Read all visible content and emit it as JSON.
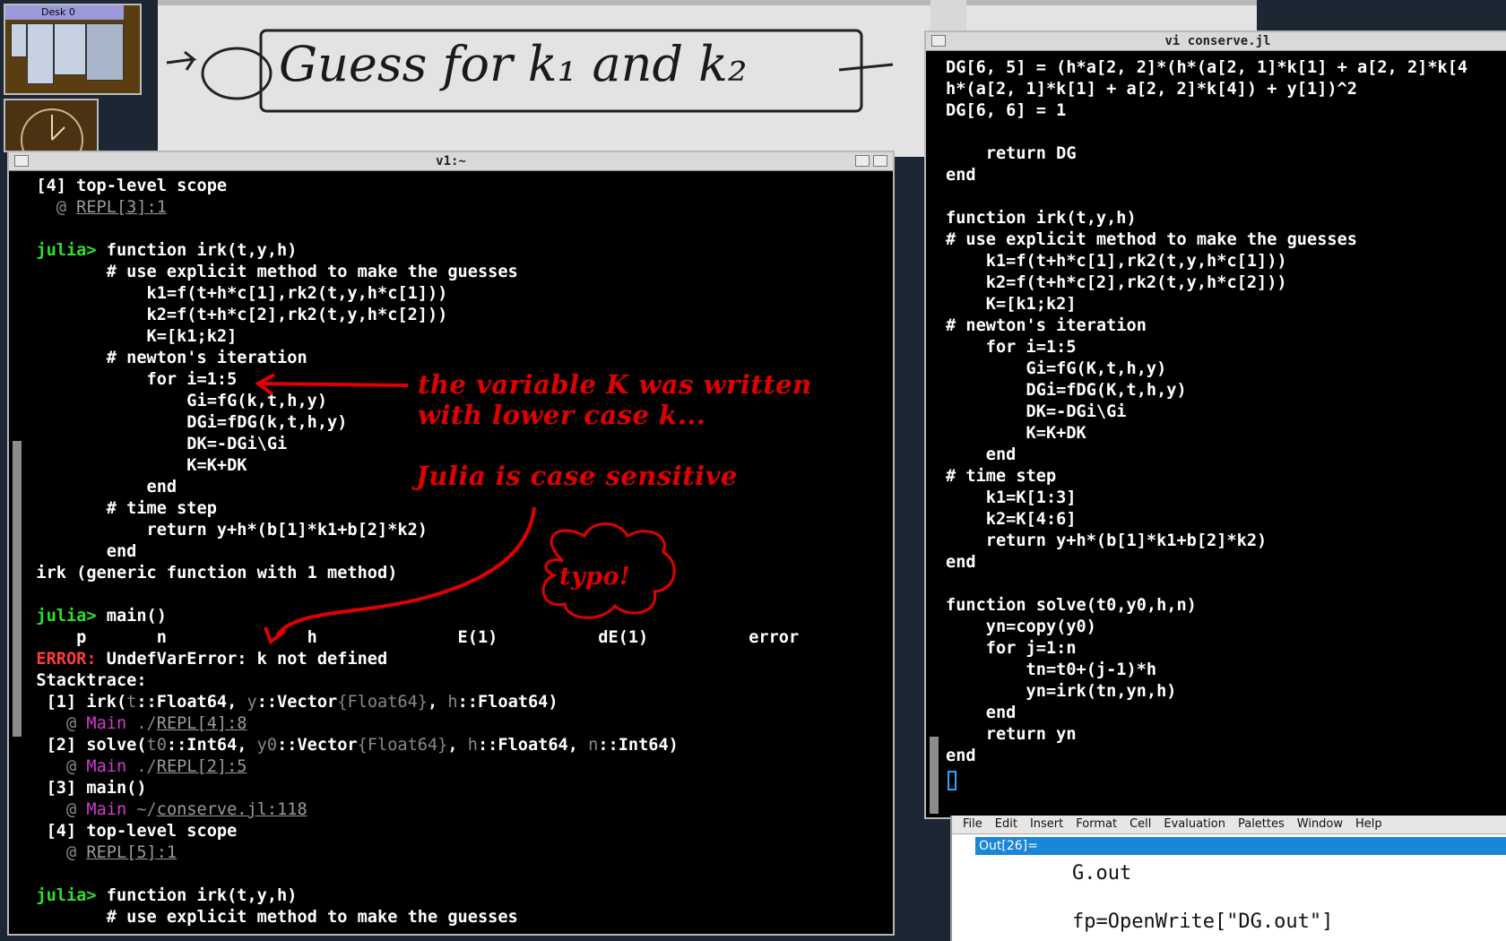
{
  "pager": {
    "title": "Desk 0"
  },
  "paper": {
    "handwriting": "Guess for k₁ and k₂"
  },
  "left_window": {
    "title": "v1:~",
    "lines": [
      [
        [
          "  [4] top-level scope",
          "b"
        ]
      ],
      [
        [
          "    @ ",
          "gr"
        ],
        [
          "REPL[3]:1",
          "u"
        ]
      ],
      [
        [
          "",
          ""
        ]
      ],
      [
        [
          "  julia> ",
          "g"
        ],
        [
          "function irk(t,y,h)",
          "b"
        ]
      ],
      [
        [
          "         # use explicit method to make the guesses",
          "b"
        ]
      ],
      [
        [
          "             k1=f(t+h*c[1],rk2(t,y,h*c[1]))",
          "b"
        ]
      ],
      [
        [
          "             k2=f(t+h*c[2],rk2(t,y,h*c[2]))",
          "b"
        ]
      ],
      [
        [
          "             K=[k1;k2]",
          "b"
        ]
      ],
      [
        [
          "         # newton's iteration",
          "b"
        ]
      ],
      [
        [
          "             for i=1:5",
          "b"
        ]
      ],
      [
        [
          "                 Gi=fG(k,t,h,y)",
          "b"
        ]
      ],
      [
        [
          "                 DGi=fDG(k,t,h,y)",
          "b"
        ]
      ],
      [
        [
          "                 DK=-DGi\\Gi",
          "b"
        ]
      ],
      [
        [
          "                 K=K+DK",
          "b"
        ]
      ],
      [
        [
          "             end",
          "b"
        ]
      ],
      [
        [
          "         # time step",
          "b"
        ]
      ],
      [
        [
          "             return y+h*(b[1]*k1+b[2]*k2)",
          "b"
        ]
      ],
      [
        [
          "         end",
          "b"
        ]
      ],
      [
        [
          "  irk (generic function with 1 method)",
          "b"
        ]
      ],
      [
        [
          "",
          ""
        ]
      ],
      [
        [
          "  julia> ",
          "g"
        ],
        [
          "main()",
          "b"
        ]
      ],
      [
        [
          "      p       n              h              E(1)          dE(1)          error",
          "b"
        ]
      ],
      [
        [
          "  ERROR: ",
          "r"
        ],
        [
          "UndefVarError: k not defined",
          "b"
        ]
      ],
      [
        [
          "  Stacktrace:",
          "b"
        ]
      ],
      [
        [
          "   [1] irk(",
          "b"
        ],
        [
          "t",
          "gr"
        ],
        [
          "::Float64, ",
          "b"
        ],
        [
          "y",
          "gr"
        ],
        [
          "::Vector",
          "b"
        ],
        [
          "{Float64}",
          "gr"
        ],
        [
          ", ",
          "b"
        ],
        [
          "h",
          "gr"
        ],
        [
          "::Float64)",
          "b"
        ]
      ],
      [
        [
          "     @ ",
          "gr"
        ],
        [
          "Main",
          "m"
        ],
        [
          " ./",
          "gr"
        ],
        [
          "REPL[4]:8",
          "u"
        ]
      ],
      [
        [
          "   [2] solve(",
          "b"
        ],
        [
          "t0",
          "gr"
        ],
        [
          "::Int64, ",
          "b"
        ],
        [
          "y0",
          "gr"
        ],
        [
          "::Vector",
          "b"
        ],
        [
          "{Float64}",
          "gr"
        ],
        [
          ", ",
          "b"
        ],
        [
          "h",
          "gr"
        ],
        [
          "::Float64, ",
          "b"
        ],
        [
          "n",
          "gr"
        ],
        [
          "::Int64)",
          "b"
        ]
      ],
      [
        [
          "     @ ",
          "gr"
        ],
        [
          "Main",
          "m"
        ],
        [
          " ./",
          "gr"
        ],
        [
          "REPL[2]:5",
          "u"
        ]
      ],
      [
        [
          "   [3] main()",
          "b"
        ]
      ],
      [
        [
          "     @ ",
          "gr"
        ],
        [
          "Main",
          "m"
        ],
        [
          " ~/",
          "gr"
        ],
        [
          "conserve.jl:118",
          "u"
        ]
      ],
      [
        [
          "   [4] top-level scope",
          "b"
        ]
      ],
      [
        [
          "     @ ",
          "gr"
        ],
        [
          "REPL[5]:1",
          "u"
        ]
      ],
      [
        [
          "",
          ""
        ]
      ],
      [
        [
          "  julia> ",
          "g"
        ],
        [
          "function irk(t,y,h)",
          "b"
        ]
      ],
      [
        [
          "         # use explicit method to make the guesses",
          "b"
        ]
      ]
    ]
  },
  "right_window": {
    "title": "vi conserve.jl",
    "lines": [
      "DG[6, 5] = (h*a[2, 2]*(h*(a[2, 1]*k[1] + a[2, 2]*k[4",
      "h*(a[2, 1]*k[1] + a[2, 2]*k[4]) + y[1])^2",
      "DG[6, 6] = 1",
      "",
      "    return DG",
      "end",
      "",
      "function irk(t,y,h)",
      "# use explicit method to make the guesses",
      "    k1=f(t+h*c[1],rk2(t,y,h*c[1]))",
      "    k2=f(t+h*c[2],rk2(t,y,h*c[2]))",
      "    K=[k1;k2]",
      "# newton's iteration",
      "    for i=1:5",
      "        Gi=fG(K,t,h,y)",
      "        DGi=fDG(K,t,h,y)",
      "        DK=-DGi\\Gi",
      "        K=K+DK",
      "    end",
      "# time step",
      "    k1=K[1:3]",
      "    k2=K[4:6]",
      "    return y+h*(b[1]*k1+b[2]*k2)",
      "end",
      "",
      "function solve(t0,y0,h,n)",
      "    yn=copy(y0)",
      "    for j=1:n",
      "        tn=t0+(j-1)*h",
      "        yn=irk(tn,yn,h)",
      "    end",
      "    return yn",
      "end"
    ]
  },
  "annotations": {
    "note1_line1": "the variable K was written",
    "note1_line2": "with lower case k...",
    "note2": "Julia is case sensitive",
    "note3": "typo!"
  },
  "mathematica": {
    "menu": [
      "File",
      "Edit",
      "Insert",
      "Format",
      "Cell",
      "Evaluation",
      "Palettes",
      "Window",
      "Help"
    ],
    "out_label": "Out[26]=",
    "cell_text": "G.out",
    "cell_text2": "fp=OpenWrite[\"DG.out\"]"
  },
  "colors": {
    "prompt": "#2be02b",
    "error": "#ff3a3a",
    "annotation": "#e00000",
    "module": "#d23ad2"
  }
}
